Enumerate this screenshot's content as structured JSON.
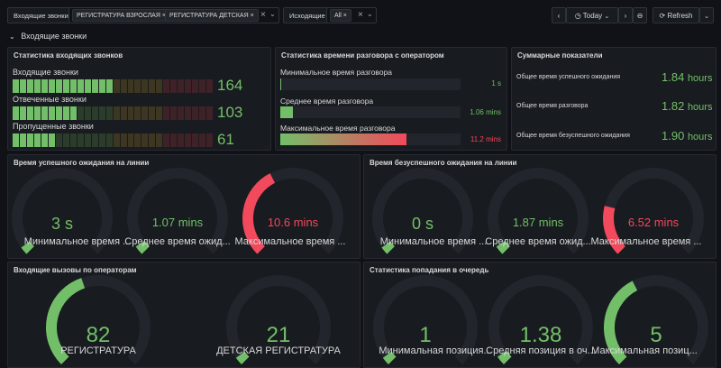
{
  "vars": {
    "incoming_label": "Входящие звонки",
    "incoming_chips": [
      "РЕГИСТРАТУРА ВЗРОСЛАЯ",
      "РЕГИСТРАТУРА ДЕТСКАЯ"
    ],
    "outgoing_label": "Исходящие",
    "outgoing_chips": [
      "All"
    ]
  },
  "timebar": {
    "range": "Today",
    "refresh": "Refresh"
  },
  "row_title": "Входящие звонки",
  "stats_incoming": {
    "title": "Статистика входящих звонков",
    "rows": [
      {
        "label": "Входящие звонки",
        "value": "164",
        "fraction": 0.5
      },
      {
        "label": "Отвеченные звонки",
        "value": "103",
        "fraction": 0.32
      },
      {
        "label": "Пропущенные звонки",
        "value": "61",
        "fraction": 0.2
      }
    ]
  },
  "stats_talk": {
    "title": "Статистика времени разговора с оператором",
    "rows": [
      {
        "label": "Минимальное время разговора",
        "value": "1 s",
        "fraction": 0.0,
        "color": "#73bf69"
      },
      {
        "label": "Среднее время разговора",
        "value": "1.06 mins",
        "fraction": 0.07,
        "color": "#73bf69"
      },
      {
        "label": "Максимальное время разговора",
        "value": "11.2 mins",
        "fraction": 0.7,
        "color": "#f2495c"
      }
    ]
  },
  "summary": {
    "title": "Суммарные показатели",
    "rows": [
      {
        "label": "Общее время успешного ожидания",
        "value": "1.84",
        "unit": "hours"
      },
      {
        "label": "Общее время разговора",
        "value": "1.82",
        "unit": "hours"
      },
      {
        "label": "Общее время безуспешного ожидания",
        "value": "1.90",
        "unit": "hours"
      }
    ]
  },
  "wait_success": {
    "title": "Время успешного ожидания на линии",
    "gauges": [
      {
        "value": "3 s",
        "label": "Минимальное время ...",
        "fraction": 0.0,
        "color": "#73bf69"
      },
      {
        "value": "1.07 mins",
        "label": "Среднее время ожид...",
        "fraction": 0.04,
        "color": "#73bf69"
      },
      {
        "value": "10.6 mins",
        "label": "Максимальное время ...",
        "fraction": 0.4,
        "color": "#f2495c"
      }
    ]
  },
  "wait_fail": {
    "title": "Время безуспешного ожидания на линии",
    "gauges": [
      {
        "value": "0 s",
        "label": "Минимальное время ...",
        "fraction": 0.0,
        "color": "#73bf69"
      },
      {
        "value": "1.87 mins",
        "label": "Среднее время ожид...",
        "fraction": 0.04,
        "color": "#73bf69"
      },
      {
        "value": "6.52 mins",
        "label": "Максимальное время ...",
        "fraction": 0.22,
        "color": "#f2495c"
      }
    ]
  },
  "operators": {
    "title": "Входящие вызовы по операторам",
    "gauges": [
      {
        "value": "82",
        "label": "РЕГИСТРАТУРА",
        "fraction": 0.43,
        "color": "#73bf69"
      },
      {
        "value": "21",
        "label": "ДЕТСКАЯ РЕГИСТРАТУРА",
        "fraction": 0.0,
        "color": "#73bf69"
      }
    ]
  },
  "queue": {
    "title": "Статистика попадания в очередь",
    "gauges": [
      {
        "value": "1",
        "label": "Минимальная позиция...",
        "fraction": 0.0,
        "color": "#73bf69"
      },
      {
        "value": "1.38",
        "label": "Средняя позиция в оч...",
        "fraction": 0.04,
        "color": "#73bf69"
      },
      {
        "value": "5",
        "label": "Максимальная позиц...",
        "fraction": 0.4,
        "color": "#73bf69"
      }
    ]
  }
}
